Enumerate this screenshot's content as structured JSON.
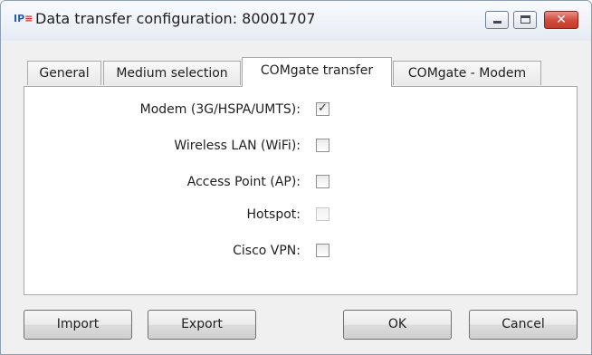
{
  "window": {
    "title": "Data transfer configuration: 80001707",
    "icon": "ipe-app-icon",
    "icon_text_a": "IP",
    "icon_text_b": "≡",
    "minimize_label": "",
    "maximize_label": "",
    "close_glyph": "✕"
  },
  "tabs": [
    {
      "label": "General",
      "active": false
    },
    {
      "label": "Medium selection",
      "active": false
    },
    {
      "label": "COMgate transfer",
      "active": true
    },
    {
      "label": "COMgate - Modem",
      "active": false
    }
  ],
  "options": [
    {
      "label": "Modem (3G/HSPA/UMTS):",
      "checked": true,
      "enabled": true,
      "mark": "✓"
    },
    {
      "label": "Wireless LAN (WiFi):",
      "checked": false,
      "enabled": true,
      "mark": ""
    },
    {
      "label": "Access Point (AP):",
      "checked": false,
      "enabled": true,
      "mark": ""
    },
    {
      "label": "Hotspot:",
      "checked": false,
      "enabled": false,
      "mark": ""
    },
    {
      "label": "Cisco VPN:",
      "checked": false,
      "enabled": true,
      "mark": ""
    }
  ],
  "buttons": {
    "import": "Import",
    "export": "Export",
    "ok": "OK",
    "cancel": "Cancel"
  },
  "colors": {
    "close_button": "#c23b2e",
    "panel_background": "#ffffff",
    "dialog_background": "#f0f0f0"
  }
}
